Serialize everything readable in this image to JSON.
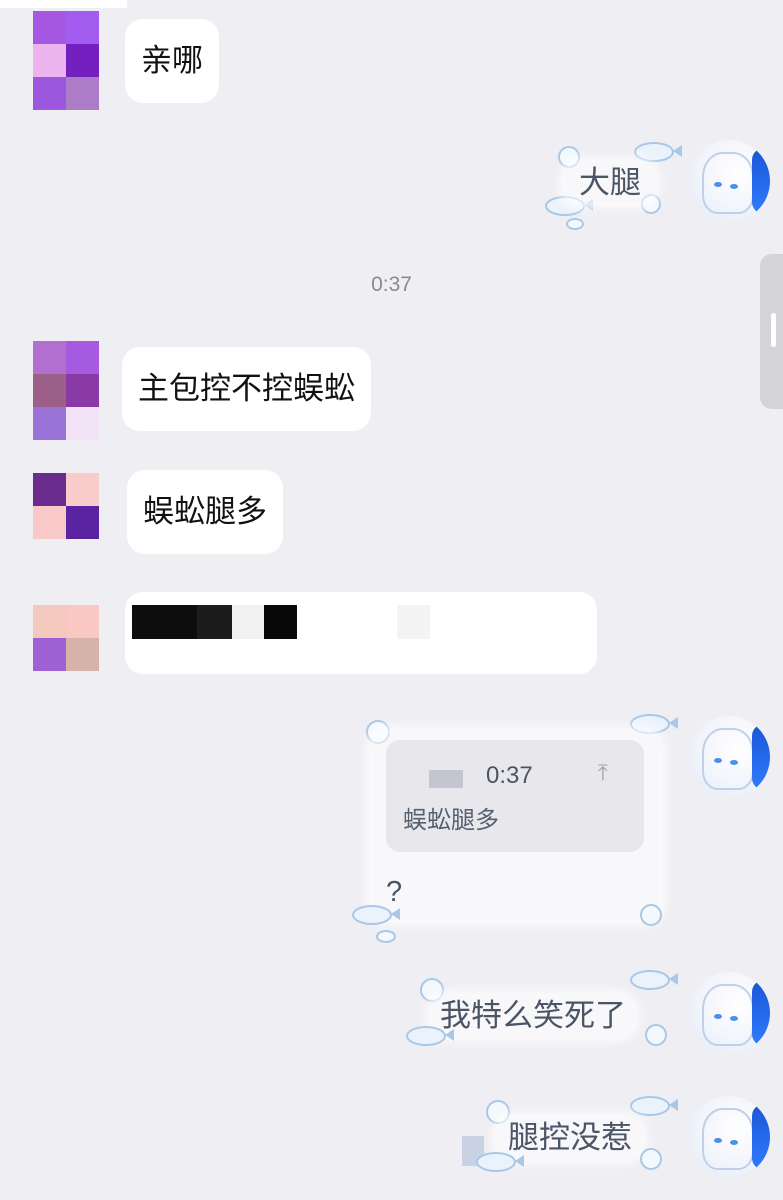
{
  "timestamp": "0:37",
  "colors": {
    "background": "#efeef3",
    "bubble_in": "#ffffff",
    "quote_card": "#e8e8ec",
    "self_text": "#4a5565"
  },
  "messages_incoming": [
    {
      "text": "亲哪"
    },
    {
      "text": "主包控不控蜈蚣"
    },
    {
      "text": "蜈蚣腿多"
    }
  ],
  "messages_outgoing": [
    {
      "text": "大腿"
    },
    {
      "text": "?"
    },
    {
      "text": "我特么笑死了"
    },
    {
      "text": "腿控没惹"
    }
  ],
  "quote": {
    "time": "0:37",
    "text": "蜈蚣腿多",
    "icon": "scroll-to-top-icon"
  },
  "avatars": {
    "incoming_1": [
      "#a758e3",
      "#a25cf0",
      "#ecb4ec",
      "#741fbf",
      "#9b58de",
      "#ad7cc7"
    ],
    "incoming_2": [
      "#b36fd0",
      "#a55ae0",
      "#9c6088",
      "#8a3aa6",
      "#9a73d8",
      "#f2e3f7"
    ],
    "incoming_3": [
      "#6a2d8d",
      "#f8cccb",
      "#f9c9c9",
      "#5a23a2"
    ],
    "incoming_4": [
      "#f4c9bd",
      "#f9c8c3",
      "#9d61d4",
      "#d5b3ab"
    ],
    "self_icon": "anime-avatar-icon"
  }
}
